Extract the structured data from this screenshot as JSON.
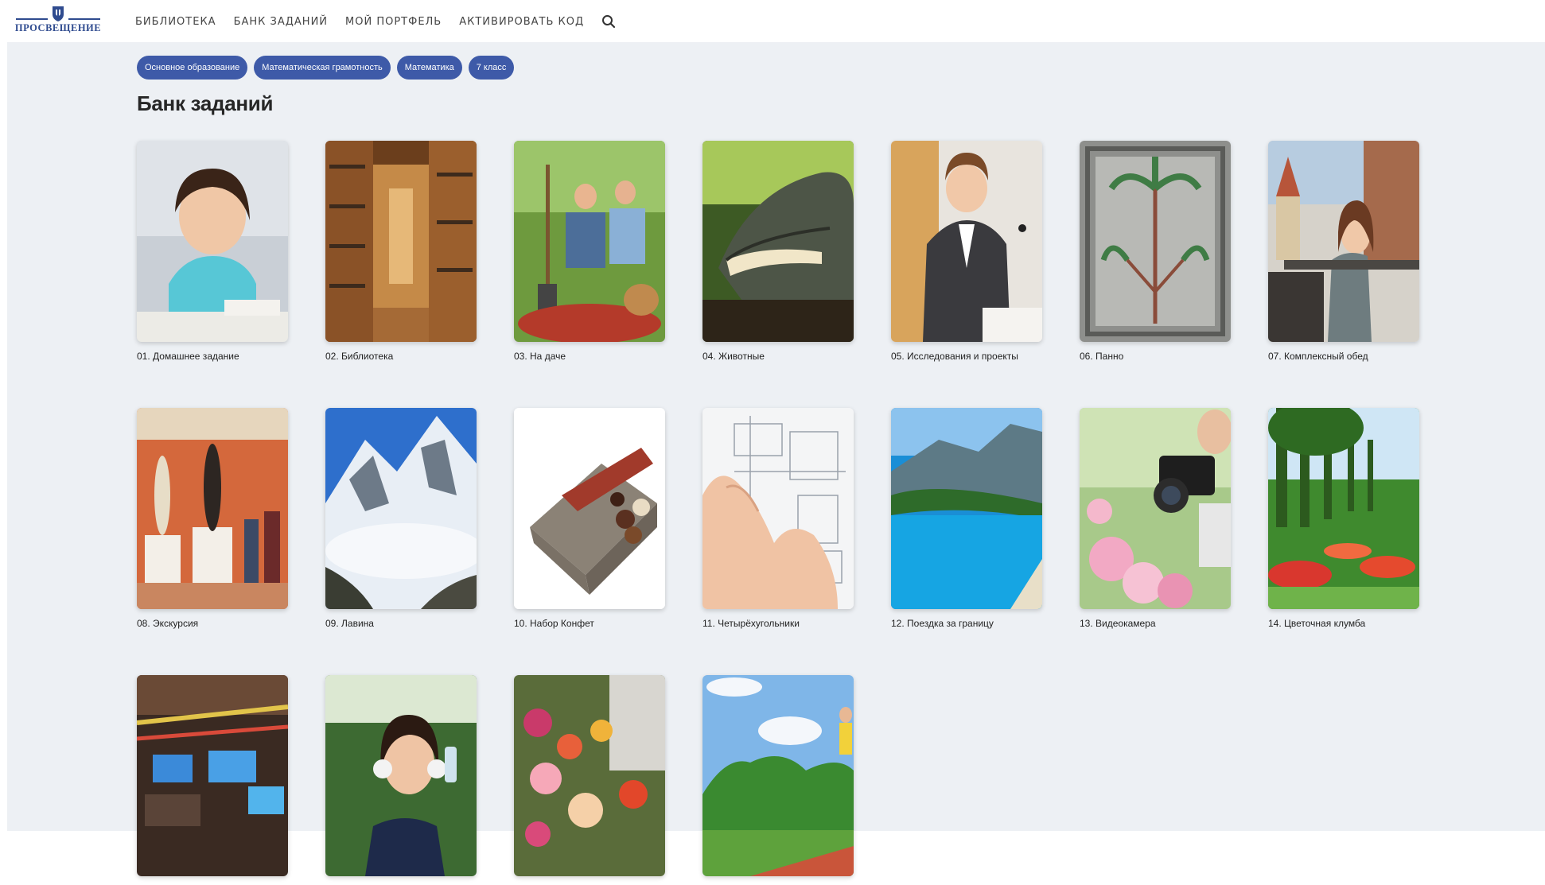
{
  "header": {
    "logo_text": "ПРОСВЕЩЕНИЕ",
    "nav": [
      {
        "label": "БИБЛИОТЕКА"
      },
      {
        "label": "БАНК ЗАДАНИЙ"
      },
      {
        "label": "МОЙ ПОРТФЕЛЬ"
      },
      {
        "label": "АКТИВИРОВАТЬ КОД"
      }
    ],
    "search_icon": "search-icon",
    "brand_color": "#2f4b8f"
  },
  "filters": {
    "chips": [
      {
        "label": "Основное образование"
      },
      {
        "label": "Математическая грамотность"
      },
      {
        "label": "Математика"
      },
      {
        "label": "7 класс"
      }
    ],
    "chip_color": "#3e5aa8"
  },
  "page_title": "Банк заданий",
  "cards": [
    {
      "title": "01. Домашнее задание",
      "image": "girl-doing-homework"
    },
    {
      "title": "02. Библиотека",
      "image": "library-shelves"
    },
    {
      "title": "03. На даче",
      "image": "couple-with-apples"
    },
    {
      "title": "04. Животные",
      "image": "crocodile"
    },
    {
      "title": "05. Исследования и проекты",
      "image": "woman-at-podium"
    },
    {
      "title": "06. Панно",
      "image": "mosaic-palm"
    },
    {
      "title": "07. Комплексный обед",
      "image": "woman-at-cafe"
    },
    {
      "title": "08. Экскурсия",
      "image": "museum-statues"
    },
    {
      "title": "09. Лавина",
      "image": "mountain-avalanche"
    },
    {
      "title": "10. Набор Конфет",
      "image": "chocolate-box"
    },
    {
      "title": "11. Четырёхугольники",
      "image": "blueprint-hand"
    },
    {
      "title": "12. Поездка за границу",
      "image": "sea-bay"
    },
    {
      "title": "13. Видеокамера",
      "image": "camera-flowers"
    },
    {
      "title": "14. Цветочная клумба",
      "image": "flower-garden"
    },
    {
      "title": "",
      "image": "electronics-store"
    },
    {
      "title": "",
      "image": "girl-headphones"
    },
    {
      "title": "",
      "image": "flower-market"
    },
    {
      "title": "",
      "image": "runner-stadium"
    }
  ]
}
